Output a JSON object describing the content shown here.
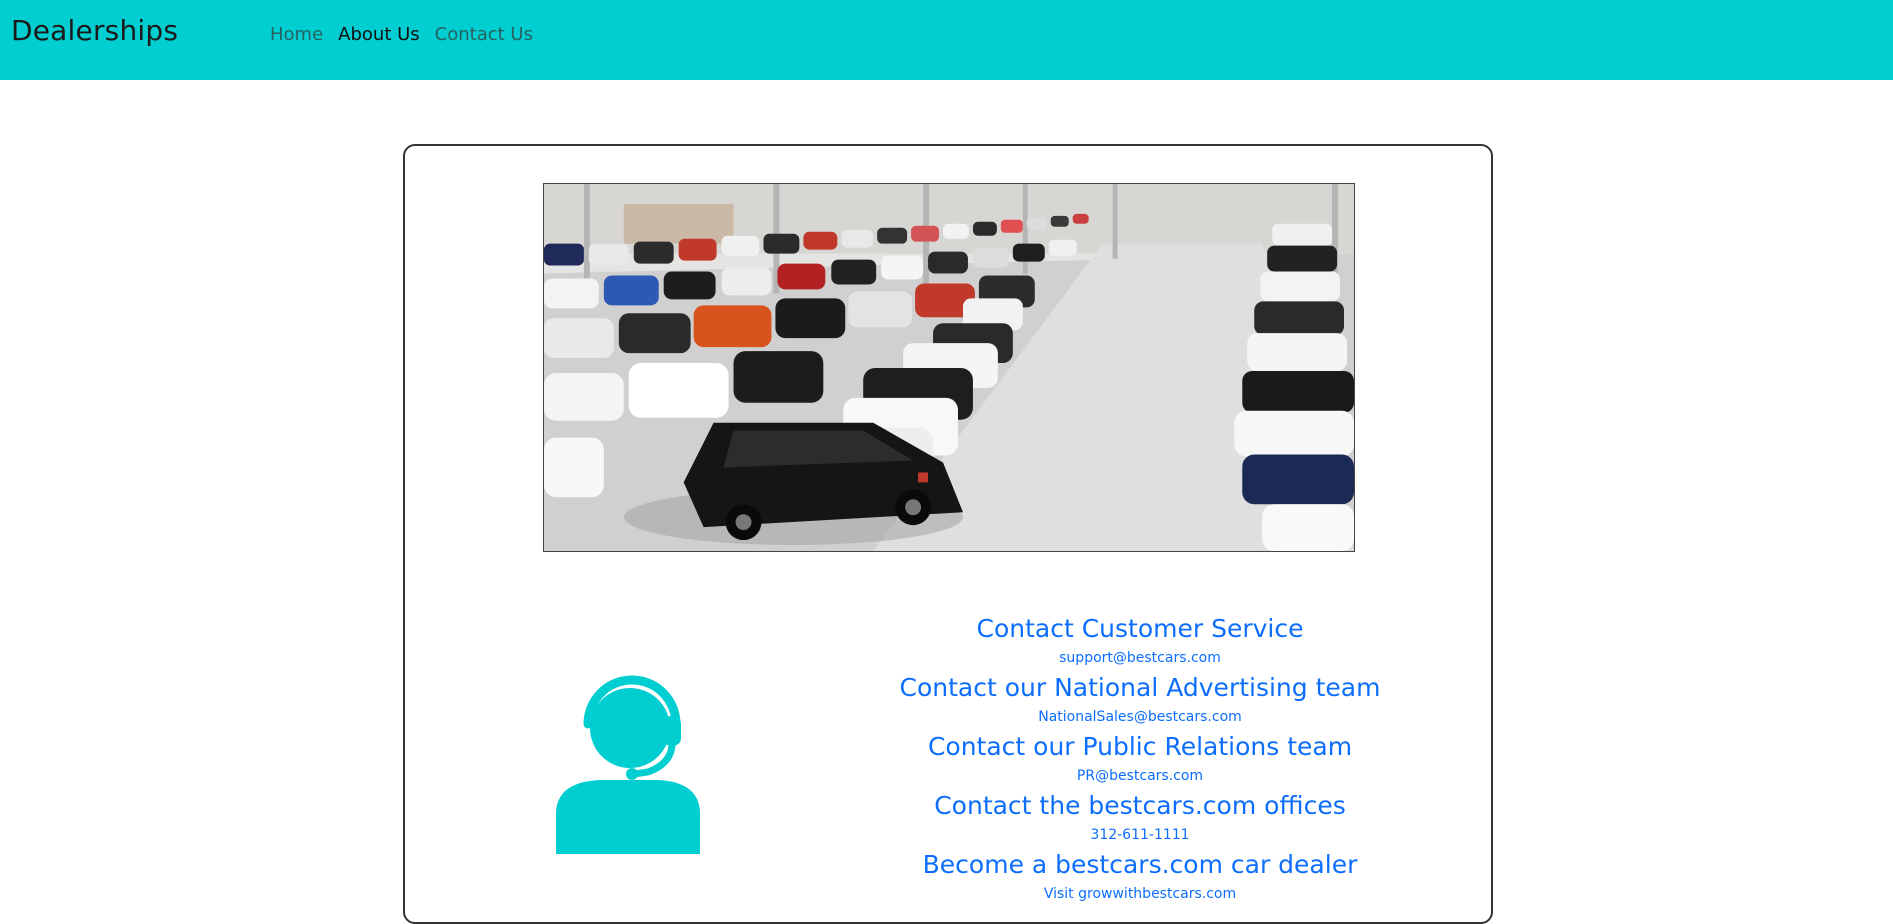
{
  "navbar": {
    "brand": "Dealerships",
    "links": [
      {
        "label": "Home",
        "active": false
      },
      {
        "label": "About Us",
        "active": true
      },
      {
        "label": "Contact Us",
        "active": false
      }
    ],
    "background_color": "#00ced1"
  },
  "hero_image": {
    "icon": "car-dealership-showroom-photo"
  },
  "agent": {
    "icon": "customer-support-headset-icon",
    "color": "#00ced1"
  },
  "contacts": [
    {
      "title": "Contact Customer Service",
      "detail": "support@bestcars.com"
    },
    {
      "title": "Contact our National Advertising team",
      "detail": "NationalSales@bestcars.com"
    },
    {
      "title": "Contact our Public Relations team",
      "detail": "PR@bestcars.com"
    },
    {
      "title": "Contact the bestcars.com offices",
      "detail": "312-611-1111"
    },
    {
      "title": "Become a bestcars.com car dealer",
      "detail": "Visit growwithbestcars.com"
    }
  ],
  "link_color": "#0d6efd"
}
